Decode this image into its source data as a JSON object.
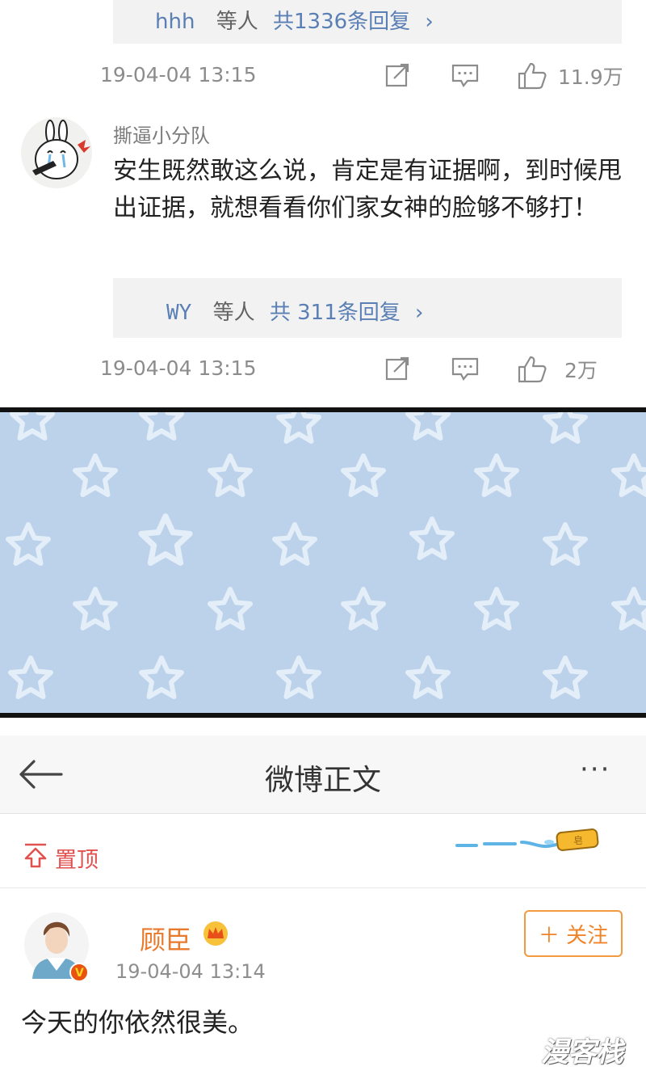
{
  "comments": [
    {
      "reply_user": "hhh",
      "reply_mid": "等人",
      "reply_count": "共1336条回复",
      "reply_arrow": "›",
      "timestamp": "19-04-04  13:15",
      "likes": "11.9万"
    },
    {
      "user": "撕逼小分队",
      "text": "安生既然敢这么说，肯定是有证据啊，到时候甩出证据，就想看看你们家女神的脸够不够打！",
      "reply_user": "WY",
      "reply_mid": "等人",
      "reply_count": "共 311条回复",
      "reply_arrow": "›",
      "timestamp": "19-04-04  13:15",
      "likes": "2万"
    }
  ],
  "weibo": {
    "back_icon": "back-arrow-icon",
    "title": "微博正文",
    "more_icon": "more-dots-icon",
    "more_label": "···",
    "pin_label": "置顶",
    "soap_label": "皂",
    "author": "顾臣",
    "verified_label": "V",
    "timestamp": "19-04-04  13:14",
    "follow_label": "＋ 关注",
    "post_text": "今天的你依然很美。"
  },
  "watermark": "漫客栈",
  "colors": {
    "star_bg": "#bcd2ea",
    "link_blue": "#5a7fb5",
    "pin_red": "#e0514f",
    "author_orange": "#e97a2c",
    "follow_orange": "#f0842a"
  }
}
